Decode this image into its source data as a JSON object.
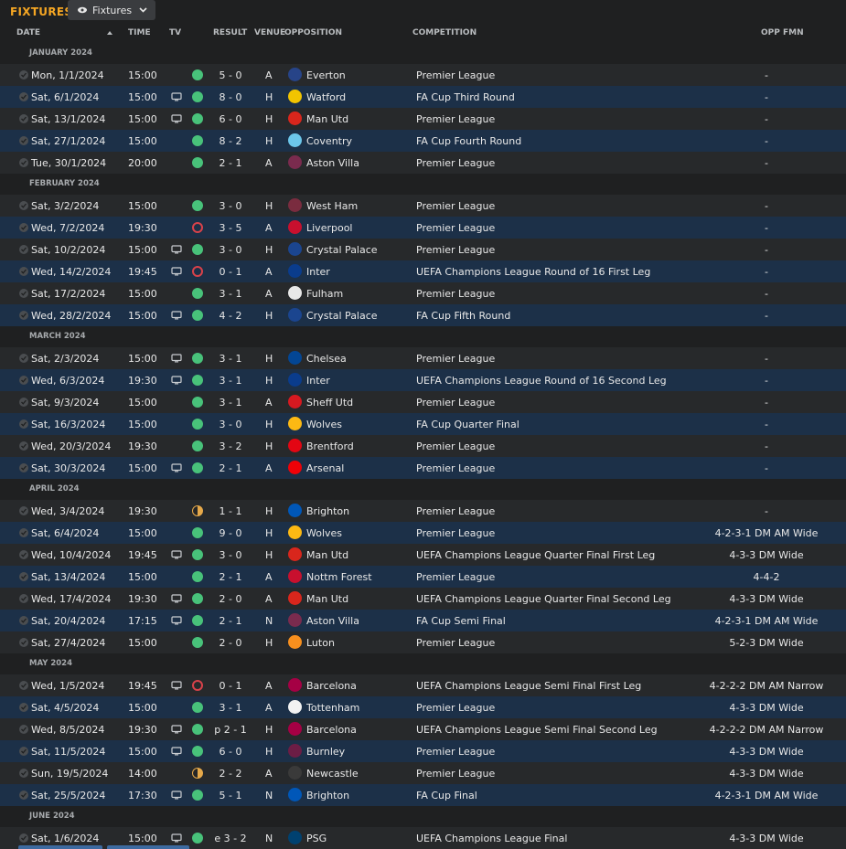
{
  "title": "FIXTURES",
  "view_button": {
    "label": "Fixtures",
    "icon": "eye-icon"
  },
  "columns": {
    "date": "DATE",
    "time": "TIME",
    "tv": "TV",
    "result": "RESULT",
    "venue": "VENUE",
    "opposition": "OPPOSITION",
    "competition": "COMPETITION",
    "opp_fmn": "OPP FMN"
  },
  "colors": {
    "accent": "#f5a623",
    "win": "#48c27a",
    "loss": "#d8424a",
    "draw": "#e6a94a",
    "row": "#27292b",
    "row_alt": "#1c3048"
  },
  "months": [
    {
      "label": "JANUARY 2024",
      "fixtures": [
        {
          "date": "Mon, 1/1/2024",
          "time": "15:00",
          "tv": false,
          "outcome": "win",
          "result": "5 - 0",
          "venue": "A",
          "opposition": "Everton",
          "crest": "#274488",
          "competition": "Premier League",
          "opp_fmn": "-"
        },
        {
          "date": "Sat, 6/1/2024",
          "time": "15:00",
          "tv": true,
          "outcome": "win",
          "result": "8 - 0",
          "venue": "H",
          "opposition": "Watford",
          "crest": "#f2c400",
          "competition": "FA Cup Third Round",
          "opp_fmn": "-"
        },
        {
          "date": "Sat, 13/1/2024",
          "time": "15:00",
          "tv": true,
          "outcome": "win",
          "result": "6 - 0",
          "venue": "H",
          "opposition": "Man Utd",
          "crest": "#d9261c",
          "competition": "Premier League",
          "opp_fmn": "-"
        },
        {
          "date": "Sat, 27/1/2024",
          "time": "15:00",
          "tv": false,
          "outcome": "win",
          "result": "8 - 2",
          "venue": "H",
          "opposition": "Coventry",
          "crest": "#6cc6ea",
          "competition": "FA Cup Fourth Round",
          "opp_fmn": "-"
        },
        {
          "date": "Tue, 30/1/2024",
          "time": "20:00",
          "tv": false,
          "outcome": "win",
          "result": "2 - 1",
          "venue": "A",
          "opposition": "Aston Villa",
          "crest": "#7a2b4e",
          "competition": "Premier League",
          "opp_fmn": "-"
        }
      ]
    },
    {
      "label": "FEBRUARY 2024",
      "fixtures": [
        {
          "date": "Sat, 3/2/2024",
          "time": "15:00",
          "tv": false,
          "outcome": "win",
          "result": "3 - 0",
          "venue": "H",
          "opposition": "West Ham",
          "crest": "#7a2c3f",
          "competition": "Premier League",
          "opp_fmn": "-"
        },
        {
          "date": "Wed, 7/2/2024",
          "time": "19:30",
          "tv": false,
          "outcome": "loss",
          "result": "3 - 5",
          "venue": "A",
          "opposition": "Liverpool",
          "crest": "#c8102e",
          "competition": "Premier League",
          "opp_fmn": "-"
        },
        {
          "date": "Sat, 10/2/2024",
          "time": "15:00",
          "tv": true,
          "outcome": "win",
          "result": "3 - 0",
          "venue": "H",
          "opposition": "Crystal Palace",
          "crest": "#1b458f",
          "competition": "Premier League",
          "opp_fmn": "-"
        },
        {
          "date": "Wed, 14/2/2024",
          "time": "19:45",
          "tv": true,
          "outcome": "loss",
          "result": "0 - 1",
          "venue": "A",
          "opposition": "Inter",
          "crest": "#0a3c8c",
          "competition": "UEFA Champions League Round of 16 First Leg",
          "opp_fmn": "-"
        },
        {
          "date": "Sat, 17/2/2024",
          "time": "15:00",
          "tv": false,
          "outcome": "win",
          "result": "3 - 1",
          "venue": "A",
          "opposition": "Fulham",
          "crest": "#e8e8e8",
          "competition": "Premier League",
          "opp_fmn": "-"
        },
        {
          "date": "Wed, 28/2/2024",
          "time": "15:00",
          "tv": true,
          "outcome": "win",
          "result": "4 - 2",
          "venue": "H",
          "opposition": "Crystal Palace",
          "crest": "#1b458f",
          "competition": "FA Cup Fifth Round",
          "opp_fmn": "-"
        }
      ]
    },
    {
      "label": "MARCH 2024",
      "fixtures": [
        {
          "date": "Sat, 2/3/2024",
          "time": "15:00",
          "tv": true,
          "outcome": "win",
          "result": "3 - 1",
          "venue": "H",
          "opposition": "Chelsea",
          "crest": "#034694",
          "competition": "Premier League",
          "opp_fmn": "-"
        },
        {
          "date": "Wed, 6/3/2024",
          "time": "19:30",
          "tv": true,
          "outcome": "win",
          "result": "3 - 1",
          "venue": "H",
          "opposition": "Inter",
          "crest": "#0a3c8c",
          "competition": "UEFA Champions League Round of 16 Second Leg",
          "opp_fmn": "-"
        },
        {
          "date": "Sat, 9/3/2024",
          "time": "15:00",
          "tv": false,
          "outcome": "win",
          "result": "3 - 1",
          "venue": "A",
          "opposition": "Sheff Utd",
          "crest": "#d71920",
          "competition": "Premier League",
          "opp_fmn": "-"
        },
        {
          "date": "Sat, 16/3/2024",
          "time": "15:00",
          "tv": false,
          "outcome": "win",
          "result": "3 - 0",
          "venue": "H",
          "opposition": "Wolves",
          "crest": "#fdb913",
          "competition": "FA Cup Quarter Final",
          "opp_fmn": "-"
        },
        {
          "date": "Wed, 20/3/2024",
          "time": "19:30",
          "tv": false,
          "outcome": "win",
          "result": "3 - 2",
          "venue": "H",
          "opposition": "Brentford",
          "crest": "#e30613",
          "competition": "Premier League",
          "opp_fmn": "-"
        },
        {
          "date": "Sat, 30/3/2024",
          "time": "15:00",
          "tv": true,
          "outcome": "win",
          "result": "2 - 1",
          "venue": "A",
          "opposition": "Arsenal",
          "crest": "#ef0107",
          "competition": "Premier League",
          "opp_fmn": "-"
        }
      ]
    },
    {
      "label": "APRIL 2024",
      "fixtures": [
        {
          "date": "Wed, 3/4/2024",
          "time": "19:30",
          "tv": false,
          "outcome": "draw",
          "result": "1 - 1",
          "venue": "H",
          "opposition": "Brighton",
          "crest": "#0057b8",
          "competition": "Premier League",
          "opp_fmn": "-"
        },
        {
          "date": "Sat, 6/4/2024",
          "time": "15:00",
          "tv": false,
          "outcome": "win",
          "result": "9 - 0",
          "venue": "H",
          "opposition": "Wolves",
          "crest": "#fdb913",
          "competition": "Premier League",
          "opp_fmn": "4-2-3-1 DM AM Wide"
        },
        {
          "date": "Wed, 10/4/2024",
          "time": "19:45",
          "tv": true,
          "outcome": "win",
          "result": "3 - 0",
          "venue": "H",
          "opposition": "Man Utd",
          "crest": "#d9261c",
          "competition": "UEFA Champions League Quarter Final First Leg",
          "opp_fmn": "4-3-3 DM Wide"
        },
        {
          "date": "Sat, 13/4/2024",
          "time": "15:00",
          "tv": false,
          "outcome": "win",
          "result": "2 - 1",
          "venue": "A",
          "opposition": "Nottm Forest",
          "crest": "#c8102e",
          "competition": "Premier League",
          "opp_fmn": "4-4-2"
        },
        {
          "date": "Wed, 17/4/2024",
          "time": "19:30",
          "tv": true,
          "outcome": "win",
          "result": "2 - 0",
          "venue": "A",
          "opposition": "Man Utd",
          "crest": "#d9261c",
          "competition": "UEFA Champions League Quarter Final Second Leg",
          "opp_fmn": "4-3-3 DM Wide"
        },
        {
          "date": "Sat, 20/4/2024",
          "time": "17:15",
          "tv": true,
          "outcome": "win",
          "result": "2 - 1",
          "venue": "N",
          "opposition": "Aston Villa",
          "crest": "#7a2b4e",
          "competition": "FA Cup Semi Final",
          "opp_fmn": "4-2-3-1 DM AM Wide"
        },
        {
          "date": "Sat, 27/4/2024",
          "time": "15:00",
          "tv": false,
          "outcome": "win",
          "result": "2 - 0",
          "venue": "H",
          "opposition": "Luton",
          "crest": "#f78f1e",
          "competition": "Premier League",
          "opp_fmn": "5-2-3 DM Wide"
        }
      ]
    },
    {
      "label": "MAY 2024",
      "fixtures": [
        {
          "date": "Wed, 1/5/2024",
          "time": "19:45",
          "tv": true,
          "outcome": "loss",
          "result": "0 - 1",
          "venue": "A",
          "opposition": "Barcelona",
          "crest": "#a50044",
          "competition": "UEFA Champions League Semi Final First Leg",
          "opp_fmn": "4-2-2-2 DM AM Narrow"
        },
        {
          "date": "Sat, 4/5/2024",
          "time": "15:00",
          "tv": false,
          "outcome": "win",
          "result": "3 - 1",
          "venue": "A",
          "opposition": "Tottenham",
          "crest": "#f2f2f2",
          "competition": "Premier League",
          "opp_fmn": "4-3-3 DM Wide"
        },
        {
          "date": "Wed, 8/5/2024",
          "time": "19:30",
          "tv": true,
          "outcome": "win",
          "result": "p 2 - 1",
          "venue": "H",
          "opposition": "Barcelona",
          "crest": "#a50044",
          "competition": "UEFA Champions League Semi Final Second Leg",
          "opp_fmn": "4-2-2-2 DM AM Narrow"
        },
        {
          "date": "Sat, 11/5/2024",
          "time": "15:00",
          "tv": true,
          "outcome": "win",
          "result": "6 - 0",
          "venue": "H",
          "opposition": "Burnley",
          "crest": "#6c1d45",
          "competition": "Premier League",
          "opp_fmn": "4-3-3 DM Wide"
        },
        {
          "date": "Sun, 19/5/2024",
          "time": "14:00",
          "tv": false,
          "outcome": "draw",
          "result": "2 - 2",
          "venue": "A",
          "opposition": "Newcastle",
          "crest": "#3a3a3a",
          "competition": "Premier League",
          "opp_fmn": "4-3-3 DM Wide"
        },
        {
          "date": "Sat, 25/5/2024",
          "time": "17:30",
          "tv": true,
          "outcome": "win",
          "result": "5 - 1",
          "venue": "N",
          "opposition": "Brighton",
          "crest": "#0057b8",
          "competition": "FA Cup Final",
          "opp_fmn": "4-2-3-1 DM AM Wide"
        }
      ]
    },
    {
      "label": "JUNE 2024",
      "fixtures": [
        {
          "date": "Sat, 1/6/2024",
          "time": "15:00",
          "tv": true,
          "outcome": "win",
          "result": "e 3 - 2",
          "venue": "N",
          "opposition": "PSG",
          "crest": "#004170",
          "competition": "UEFA Champions League Final",
          "opp_fmn": "4-3-3 DM Wide"
        }
      ]
    }
  ]
}
